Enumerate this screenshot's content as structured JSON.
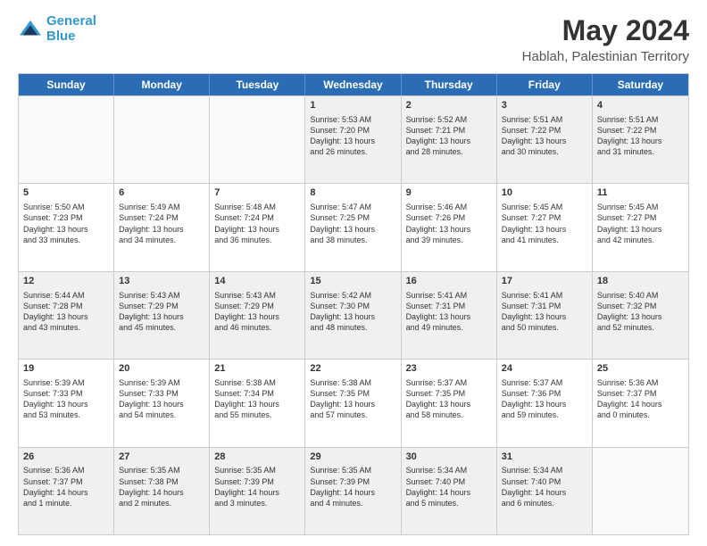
{
  "header": {
    "logo_line1": "General",
    "logo_line2": "Blue",
    "month": "May 2024",
    "location": "Hablah, Palestinian Territory"
  },
  "weekdays": [
    "Sunday",
    "Monday",
    "Tuesday",
    "Wednesday",
    "Thursday",
    "Friday",
    "Saturday"
  ],
  "weeks": [
    [
      {
        "day": "",
        "text": ""
      },
      {
        "day": "",
        "text": ""
      },
      {
        "day": "",
        "text": ""
      },
      {
        "day": "1",
        "text": "Sunrise: 5:53 AM\nSunset: 7:20 PM\nDaylight: 13 hours\nand 26 minutes."
      },
      {
        "day": "2",
        "text": "Sunrise: 5:52 AM\nSunset: 7:21 PM\nDaylight: 13 hours\nand 28 minutes."
      },
      {
        "day": "3",
        "text": "Sunrise: 5:51 AM\nSunset: 7:22 PM\nDaylight: 13 hours\nand 30 minutes."
      },
      {
        "day": "4",
        "text": "Sunrise: 5:51 AM\nSunset: 7:22 PM\nDaylight: 13 hours\nand 31 minutes."
      }
    ],
    [
      {
        "day": "5",
        "text": "Sunrise: 5:50 AM\nSunset: 7:23 PM\nDaylight: 13 hours\nand 33 minutes."
      },
      {
        "day": "6",
        "text": "Sunrise: 5:49 AM\nSunset: 7:24 PM\nDaylight: 13 hours\nand 34 minutes."
      },
      {
        "day": "7",
        "text": "Sunrise: 5:48 AM\nSunset: 7:24 PM\nDaylight: 13 hours\nand 36 minutes."
      },
      {
        "day": "8",
        "text": "Sunrise: 5:47 AM\nSunset: 7:25 PM\nDaylight: 13 hours\nand 38 minutes."
      },
      {
        "day": "9",
        "text": "Sunrise: 5:46 AM\nSunset: 7:26 PM\nDaylight: 13 hours\nand 39 minutes."
      },
      {
        "day": "10",
        "text": "Sunrise: 5:45 AM\nSunset: 7:27 PM\nDaylight: 13 hours\nand 41 minutes."
      },
      {
        "day": "11",
        "text": "Sunrise: 5:45 AM\nSunset: 7:27 PM\nDaylight: 13 hours\nand 42 minutes."
      }
    ],
    [
      {
        "day": "12",
        "text": "Sunrise: 5:44 AM\nSunset: 7:28 PM\nDaylight: 13 hours\nand 43 minutes."
      },
      {
        "day": "13",
        "text": "Sunrise: 5:43 AM\nSunset: 7:29 PM\nDaylight: 13 hours\nand 45 minutes."
      },
      {
        "day": "14",
        "text": "Sunrise: 5:43 AM\nSunset: 7:29 PM\nDaylight: 13 hours\nand 46 minutes."
      },
      {
        "day": "15",
        "text": "Sunrise: 5:42 AM\nSunset: 7:30 PM\nDaylight: 13 hours\nand 48 minutes."
      },
      {
        "day": "16",
        "text": "Sunrise: 5:41 AM\nSunset: 7:31 PM\nDaylight: 13 hours\nand 49 minutes."
      },
      {
        "day": "17",
        "text": "Sunrise: 5:41 AM\nSunset: 7:31 PM\nDaylight: 13 hours\nand 50 minutes."
      },
      {
        "day": "18",
        "text": "Sunrise: 5:40 AM\nSunset: 7:32 PM\nDaylight: 13 hours\nand 52 minutes."
      }
    ],
    [
      {
        "day": "19",
        "text": "Sunrise: 5:39 AM\nSunset: 7:33 PM\nDaylight: 13 hours\nand 53 minutes."
      },
      {
        "day": "20",
        "text": "Sunrise: 5:39 AM\nSunset: 7:33 PM\nDaylight: 13 hours\nand 54 minutes."
      },
      {
        "day": "21",
        "text": "Sunrise: 5:38 AM\nSunset: 7:34 PM\nDaylight: 13 hours\nand 55 minutes."
      },
      {
        "day": "22",
        "text": "Sunrise: 5:38 AM\nSunset: 7:35 PM\nDaylight: 13 hours\nand 57 minutes."
      },
      {
        "day": "23",
        "text": "Sunrise: 5:37 AM\nSunset: 7:35 PM\nDaylight: 13 hours\nand 58 minutes."
      },
      {
        "day": "24",
        "text": "Sunrise: 5:37 AM\nSunset: 7:36 PM\nDaylight: 13 hours\nand 59 minutes."
      },
      {
        "day": "25",
        "text": "Sunrise: 5:36 AM\nSunset: 7:37 PM\nDaylight: 14 hours\nand 0 minutes."
      }
    ],
    [
      {
        "day": "26",
        "text": "Sunrise: 5:36 AM\nSunset: 7:37 PM\nDaylight: 14 hours\nand 1 minute."
      },
      {
        "day": "27",
        "text": "Sunrise: 5:35 AM\nSunset: 7:38 PM\nDaylight: 14 hours\nand 2 minutes."
      },
      {
        "day": "28",
        "text": "Sunrise: 5:35 AM\nSunset: 7:39 PM\nDaylight: 14 hours\nand 3 minutes."
      },
      {
        "day": "29",
        "text": "Sunrise: 5:35 AM\nSunset: 7:39 PM\nDaylight: 14 hours\nand 4 minutes."
      },
      {
        "day": "30",
        "text": "Sunrise: 5:34 AM\nSunset: 7:40 PM\nDaylight: 14 hours\nand 5 minutes."
      },
      {
        "day": "31",
        "text": "Sunrise: 5:34 AM\nSunset: 7:40 PM\nDaylight: 14 hours\nand 6 minutes."
      },
      {
        "day": "",
        "text": ""
      }
    ]
  ]
}
